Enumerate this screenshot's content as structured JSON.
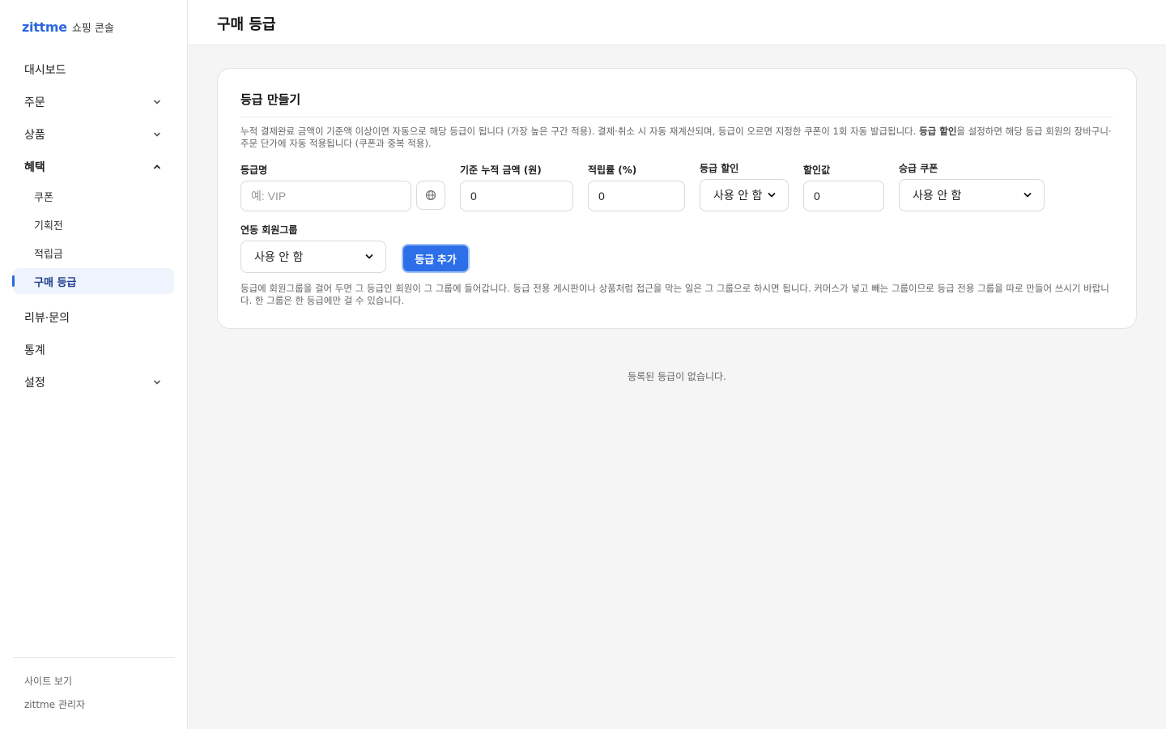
{
  "brand": {
    "name": "zittme",
    "subtitle": "쇼핑 콘솔"
  },
  "sidebar": {
    "dashboard": "대시보드",
    "orders": "주문",
    "products": "상품",
    "benefits": "혜택",
    "benefits_sub": {
      "coupon": "쿠폰",
      "promotion": "기획전",
      "points": "적립금",
      "purchase_grade": "구매 등급"
    },
    "reviews": "리뷰·문의",
    "stats": "통계",
    "settings": "설정",
    "site_link": "사이트 보기",
    "admin_user": "zittme 관리자"
  },
  "header": {
    "title": "구매 등급"
  },
  "card": {
    "title": "등급 만들기",
    "desc_part1": "누적 결제완료 금액이 기준액 이상이면 자동으로 해당 등급이 됩니다 (가장 높은 구간 적용). 결제·취소 시 자동 재계산되며, 등급이 오르면 지정한 쿠폰이 1회 자동 발급됩니다. ",
    "desc_strong": "등급 할인",
    "desc_part2": "을 설정하면 해당 등급 회원의 장바구니·주문 단가에 자동 적용됩니다 (쿠폰과 중복 적용).",
    "labels": {
      "grade_name": "등급명",
      "threshold": "기준 누적 금액 (원)",
      "point_rate": "적립률 (%)",
      "grade_discount": "등급 할인",
      "discount_value": "할인값",
      "upgrade_coupon": "승급 쿠폰",
      "member_group": "연동 회원그룹"
    },
    "fields": {
      "grade_name_placeholder": "예: VIP",
      "threshold": "0",
      "point_rate": "0",
      "grade_discount": "사용 안 함",
      "discount_value": "0",
      "upgrade_coupon": "사용 안 함",
      "member_group": "사용 안 함"
    },
    "add_button": "등급 추가",
    "note": "등급에 회원그룹을 걸어 두면 그 등급인 회원이 그 그룹에 들어갑니다. 등급 전용 게시판이나 상품처럼 접근을 막는 일은 그 그룹으로 하시면 됩니다. 커머스가 넣고 빼는 그룹이므로 등급 전용 그룹을 따로 만들어 쓰시기 바랍니다. 한 그룹은 한 등급에만 걸 수 있습니다."
  },
  "empty_message": "등록된 등급이 없습니다.",
  "colors": {
    "accent": "#2d6fe8",
    "brand": "#2d67df",
    "active_bg": "#eef3fd"
  }
}
